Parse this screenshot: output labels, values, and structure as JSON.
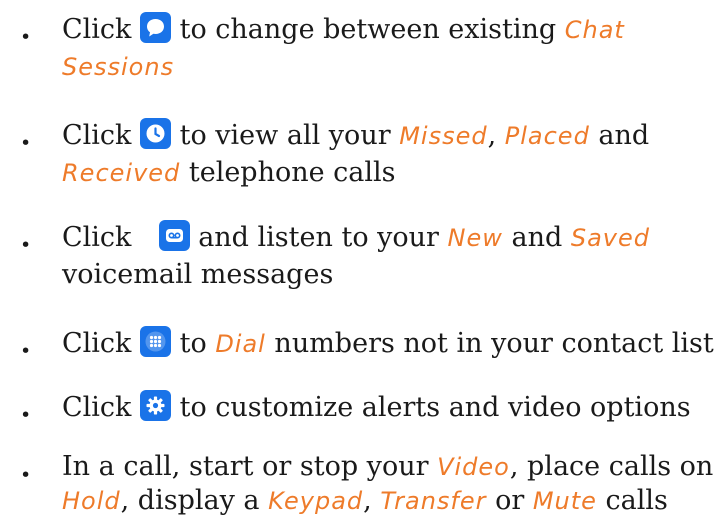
{
  "items": [
    {
      "lines": [
        {
          "pre": "Click",
          "icon": "chat-bubble-icon",
          "post": " to change between existing ",
          "hl1": "Chat"
        },
        {
          "hl1": "Sessions"
        }
      ]
    },
    {
      "lines": [
        {
          "pre": "Click",
          "icon": "clock-icon",
          "post": " to view all your ",
          "hl1": "Missed",
          "mid1": ", ",
          "hl2": "Placed",
          "mid2": " and"
        },
        {
          "hl1": "Received",
          "mid1": " telephone calls"
        }
      ]
    },
    {
      "lines": [
        {
          "pre": "Click ",
          "icon": "voicemail-icon",
          "post": "  and listen to your ",
          "hl1": "New",
          "mid1": " and ",
          "hl2": "Saved"
        },
        {
          "text": "voicemail messages"
        }
      ]
    },
    {
      "lines": [
        {
          "pre": "Click",
          "icon": "dialpad-icon",
          "post": " to ",
          "hl1": "Dial",
          "mid1": " numbers not in your contact list"
        }
      ]
    },
    {
      "lines": [
        {
          "pre": "Click",
          "icon": "gear-icon",
          "post": " to customize alerts and video options"
        }
      ]
    },
    {
      "lines": [
        {
          "text": "In a call, start or stop your ",
          "hl1": "Video",
          "mid1": ", place calls on"
        },
        {
          "hl1": "Hold",
          "mid1": ", display a ",
          "hl2": "Keypad",
          "mid2": ", ",
          "hl3": "Transfer",
          "mid3": " or ",
          "hl4": "Mute",
          "mid4": " calls"
        }
      ]
    }
  ],
  "bullet_glyph": "•",
  "accent_color": "#ee7b2a",
  "icon_color": "#1a73e8"
}
